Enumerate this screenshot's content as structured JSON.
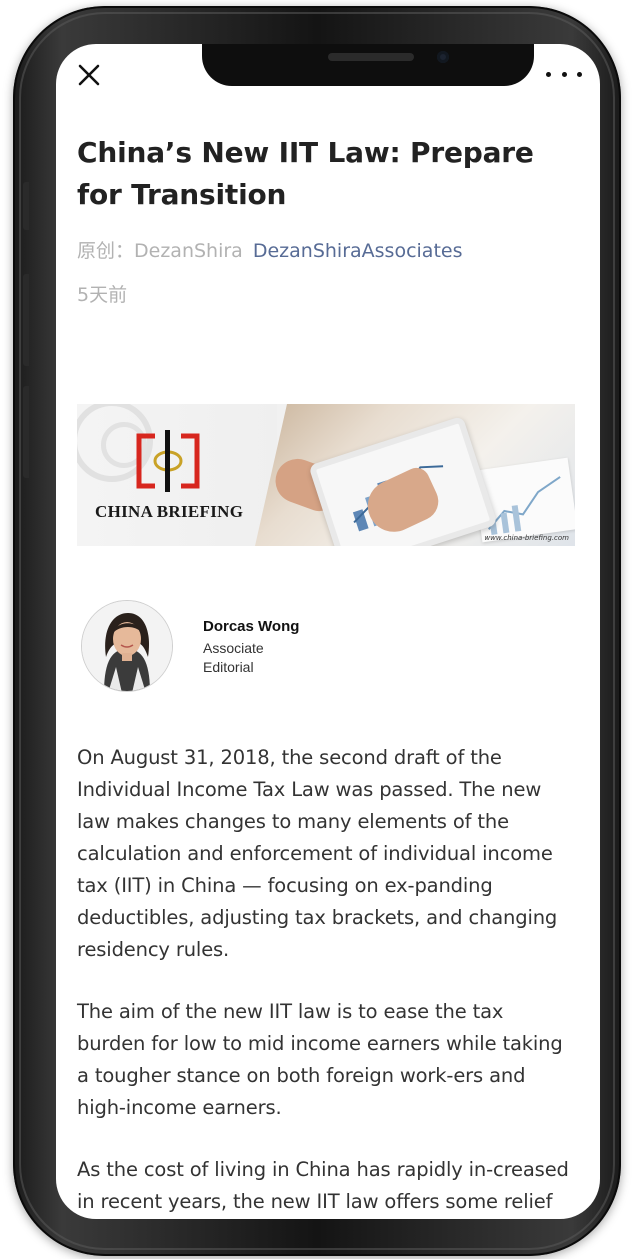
{
  "article": {
    "title": "China’s New IIT Law: Prepare for Transition",
    "meta": {
      "original_label": "原创：",
      "author": "DezanShira",
      "account": "DezanShiraAssociates",
      "time": "5天前"
    },
    "banner": {
      "brand": "CHINA BRIEFING",
      "url": "www.china-briefing.com"
    },
    "byline": {
      "name": "Dorcas Wong",
      "role_line1": "Associate",
      "role_line2": "Editorial"
    },
    "paragraphs": [
      "On August 31, 2018, the second draft of the Individual Income Tax Law was passed. The new law makes changes to many elements of the calculation and enforcement of individual income tax (IIT) in China — focusing on ex-panding deductibles, adjusting tax brackets, and changing residency rules.",
      "The aim of the new IIT law is to ease the tax burden for low to mid income earners while taking a tougher stance on both foreign work-ers and high-income earners.",
      "As the cost of living in China has rapidly in-creased in recent years, the new IIT law offers some relief for lower income earners by reduc-ing their tax burden."
    ]
  },
  "icons": {
    "close": "close-icon",
    "more": "more-icon"
  },
  "colors": {
    "title": "#222222",
    "meta_gray": "#b2b2b2",
    "account_link": "#576b95",
    "body_text": "#333333",
    "logo_red": "#d7261e",
    "logo_gold": "#c9a227"
  }
}
